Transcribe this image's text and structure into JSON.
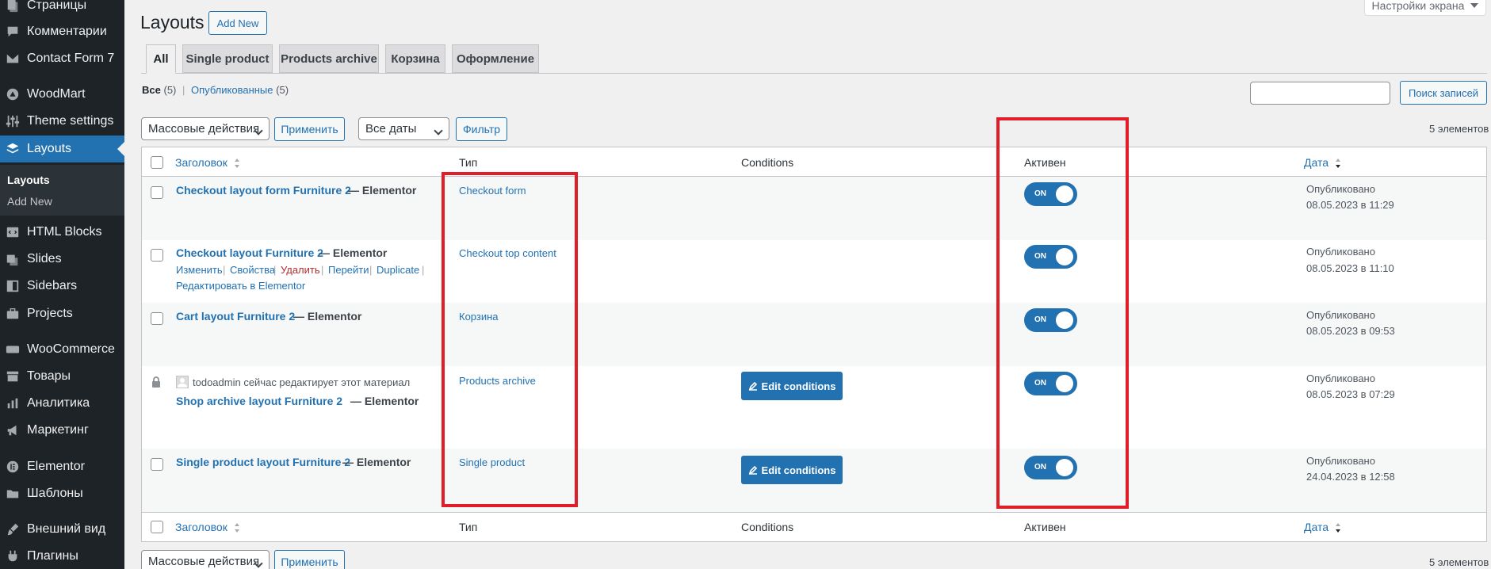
{
  "sidebar": {
    "items": [
      {
        "label": "Страницы",
        "icon": "pages-icon"
      },
      {
        "label": "Комментарии",
        "icon": "comments-icon"
      },
      {
        "label": "Contact Form 7",
        "icon": "mail-icon"
      },
      {
        "label": "WoodMart",
        "icon": "woodmart-icon"
      },
      {
        "label": "Theme settings",
        "icon": "sliders-icon"
      },
      {
        "label": "Layouts",
        "icon": "layers-icon"
      },
      {
        "label": "HTML Blocks",
        "icon": "html-icon"
      },
      {
        "label": "Slides",
        "icon": "slides-icon"
      },
      {
        "label": "Sidebars",
        "icon": "sidebars-icon"
      },
      {
        "label": "Projects",
        "icon": "briefcase-icon"
      },
      {
        "label": "WooCommerce",
        "icon": "woo-icon"
      },
      {
        "label": "Товары",
        "icon": "archive-icon"
      },
      {
        "label": "Аналитика",
        "icon": "chart-icon"
      },
      {
        "label": "Маркетинг",
        "icon": "megaphone-icon"
      },
      {
        "label": "Elementor",
        "icon": "elementor-icon"
      },
      {
        "label": "Шаблоны",
        "icon": "folder-icon"
      },
      {
        "label": "Внешний вид",
        "icon": "brush-icon"
      },
      {
        "label": "Плагины",
        "icon": "plugin-icon"
      }
    ],
    "submenu": {
      "layouts": "Layouts",
      "add_new": "Add New"
    }
  },
  "header": {
    "title": "Layouts",
    "add_new": "Add New",
    "screen_options": "Настройки экрана"
  },
  "tabs": [
    "All",
    "Single product",
    "Products archive",
    "Корзина",
    "Оформление"
  ],
  "views": {
    "all": "Все",
    "all_count": "(5)",
    "sep": "|",
    "published": "Опубликованные",
    "published_count": "(5)"
  },
  "search": {
    "placeholder": "",
    "button": "Поиск записей"
  },
  "tablenav": {
    "bulk_actions": "Массовые действия",
    "apply": "Применить",
    "all_dates": "Все даты",
    "filter": "Фильтр",
    "items_count": "5 элементов"
  },
  "table": {
    "columns": {
      "title": "Заголовок",
      "type": "Тип",
      "conditions": "Conditions",
      "active": "Активен",
      "date": "Дата"
    },
    "rows": [
      {
        "title": "Checkout layout form Furniture 2",
        "suffix": "— Elementor",
        "type": "Checkout form",
        "active": "ON",
        "status": "Опубликовано",
        "date": "08.05.2023 в 11:29"
      },
      {
        "title": "Checkout layout Furniture 2",
        "suffix": "— Elementor",
        "type": "Checkout top content",
        "active": "ON",
        "status": "Опубликовано",
        "date": "08.05.2023 в 11:10",
        "row_actions": {
          "edit": "Изменить",
          "properties": "Свойства",
          "delete": "Удалить",
          "view": "Перейти",
          "duplicate": "Duplicate",
          "edit_elementor": "Редактировать в Elementor"
        }
      },
      {
        "title": "Cart layout Furniture 2",
        "suffix": "— Elementor",
        "type": "Корзина",
        "active": "ON",
        "status": "Опубликовано",
        "date": "08.05.2023 в 09:53"
      },
      {
        "title": "Shop archive layout Furniture 2",
        "suffix": "— Elementor",
        "type": "Products archive",
        "active": "ON",
        "status": "Опубликовано",
        "date": "08.05.2023 в 07:29",
        "lock_notice": "todoadmin сейчас редактирует этот материал",
        "conditions_button": "Edit conditions"
      },
      {
        "title": "Single product layout Furniture 2",
        "suffix": "— Elementor",
        "type": "Single product",
        "active": "ON",
        "status": "Опубликовано",
        "date": "24.04.2023 в 12:58",
        "conditions_button": "Edit conditions"
      }
    ]
  },
  "colors": {
    "accent": "#2271b1",
    "sidebar_bg": "#1d2327",
    "highlight": "#e11d2a",
    "delete": "#b32d2e"
  }
}
